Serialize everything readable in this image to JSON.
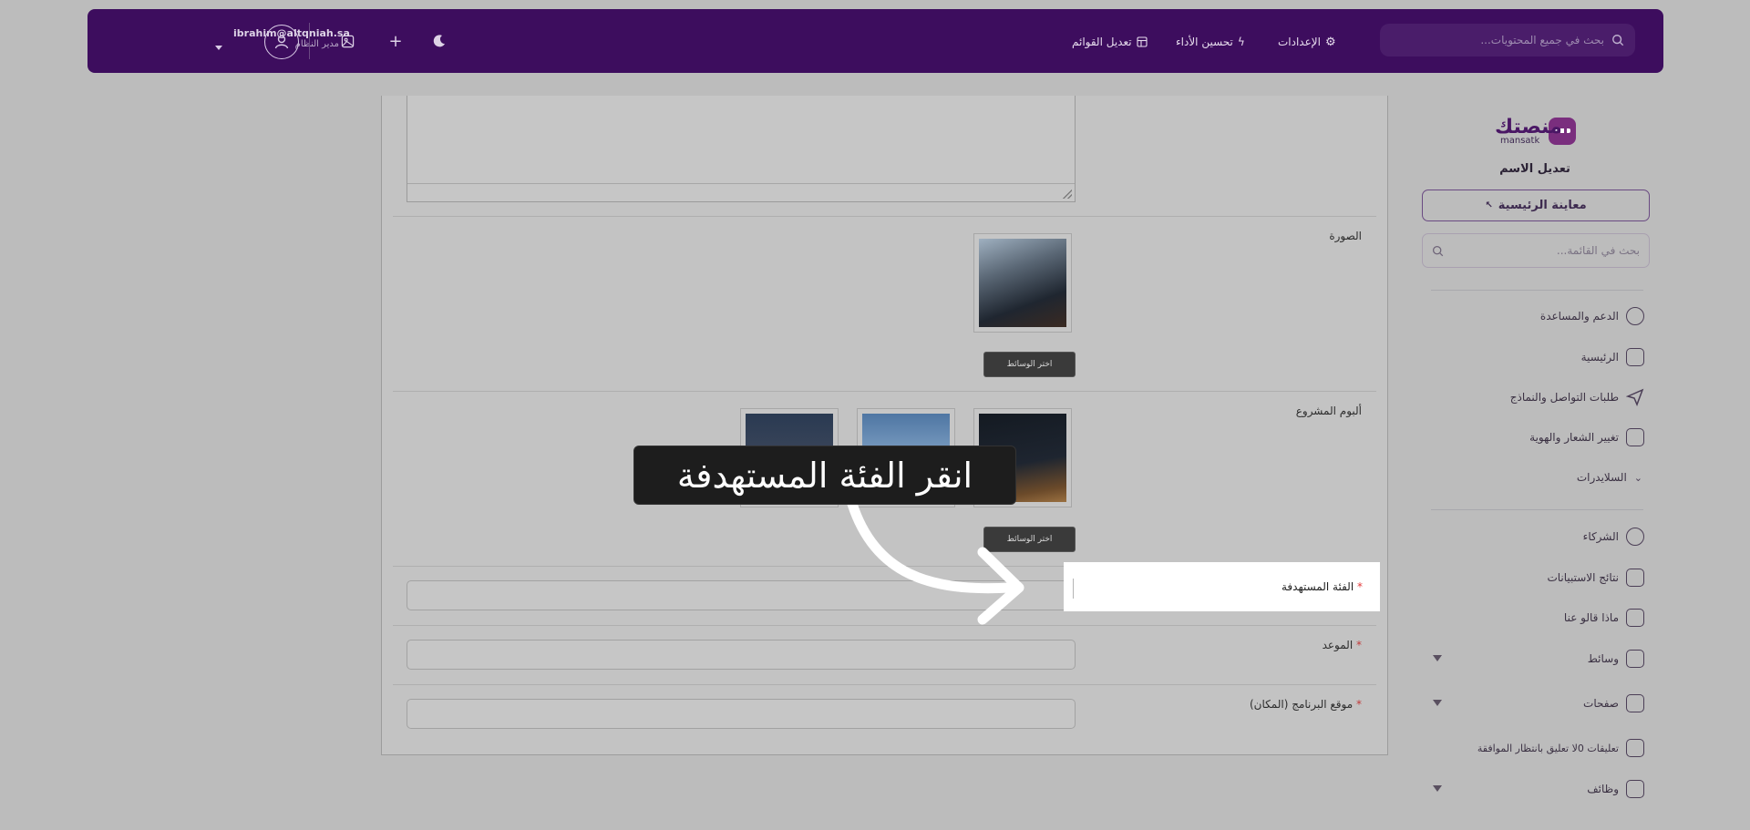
{
  "header": {
    "user_email": "ibrahim@altqniah.sa",
    "user_role": "مدير النظام",
    "links": {
      "edit_menus": "تعديل القوائم",
      "performance": "تحسين الأداء",
      "settings": "الإعدادات"
    },
    "search_placeholder": "بحث في جميع المحتويات..."
  },
  "sidebar": {
    "logo_text": "منصتك",
    "logo_sub": "mansatk",
    "site_name": "تعديل الاسم",
    "preview_label": "معاينة الرئيسية",
    "search_placeholder": "بحث في القائمة...",
    "items": [
      {
        "label": "الدعم والمساعدة",
        "icon": "help-circle-icon"
      },
      {
        "label": "الرئيسية",
        "icon": "home-icon"
      },
      {
        "label": "طلبات التواصل والنماذج",
        "icon": "send-icon"
      },
      {
        "label": "تغيير الشعار والهوية",
        "icon": "layout-icon"
      },
      {
        "label": "السلايدرات",
        "icon": "chevron-down-icon"
      },
      {
        "label": "الشركاء",
        "icon": "handshake-icon"
      },
      {
        "label": "نتائج الاستبيانات",
        "icon": "grid-icon"
      },
      {
        "label": "ماذا قالو عنا",
        "icon": "crown-icon"
      },
      {
        "label": "وسائط",
        "icon": "image-icon"
      },
      {
        "label": "صفحات",
        "icon": "pages-icon"
      },
      {
        "label": "تعليقات 0لا تعليق بانتظار الموافقة",
        "icon": "comment-icon"
      },
      {
        "label": "وظائف",
        "icon": "briefcase-icon"
      }
    ]
  },
  "form": {
    "image_label": "الصورة",
    "album_label": "ألبوم المشروع",
    "choose_media": "اختر الوسائط",
    "target_label": "الفئة المستهدفة",
    "date_label": "الموعد",
    "location_label": "موقع البرنامج (المكان)",
    "required_mark": "*"
  },
  "tooltip": {
    "text": "انقر الفئة المستهدفة"
  },
  "colors": {
    "header_bg": "#3d0d5e",
    "brand": "#4a1765",
    "required": "#e33b3b"
  }
}
